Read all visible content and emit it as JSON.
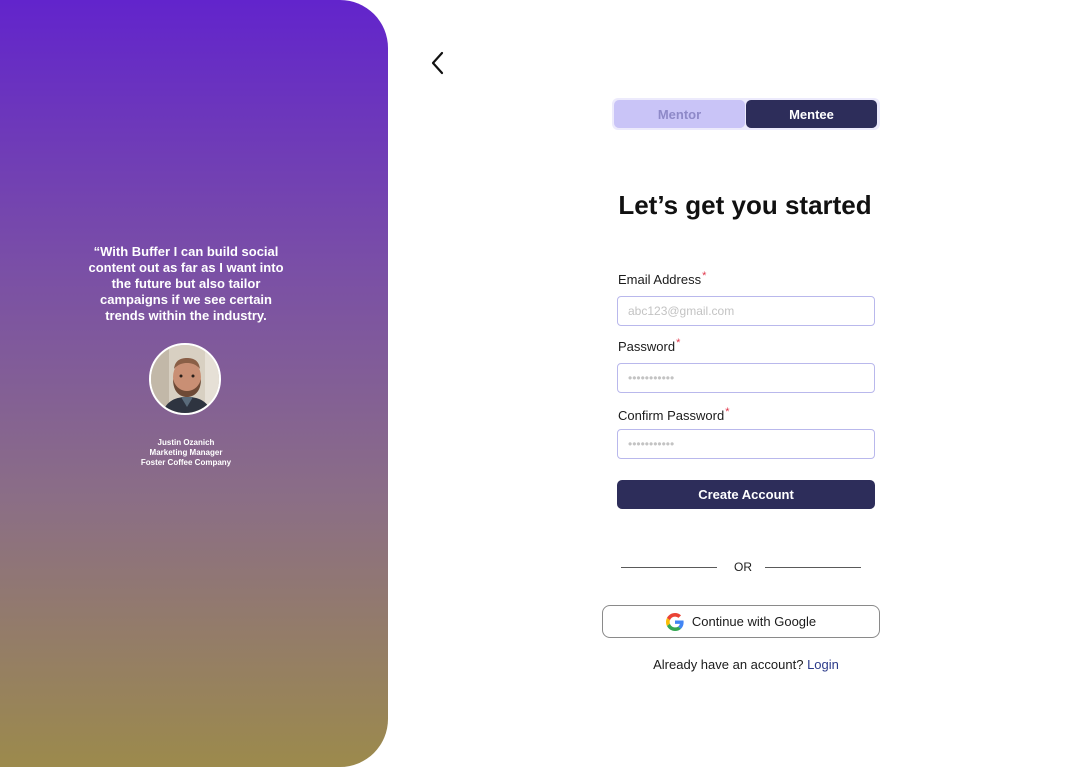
{
  "testimonial": {
    "quote": "“With Buffer I can build social content out as far as I want into the future but also tailor campaigns if we see certain trends within the industry.",
    "author_name": "Justin Ozanich",
    "author_role": "Marketing Manager",
    "author_company": "Foster Coffee Company"
  },
  "nav": {
    "back_icon": "chevron-left-icon"
  },
  "role_toggle": {
    "mentor_label": "Mentor",
    "mentee_label": "Mentee",
    "selected": "Mentee"
  },
  "form": {
    "title": "Let’s get you started",
    "email_label": "Email Address",
    "email_placeholder": "abc123@gmail.com",
    "password_label": "Password",
    "password_placeholder": "•••••••••••",
    "confirm_label": "Confirm Password",
    "confirm_placeholder": "•••••••••••",
    "required_mark": "*",
    "submit_label": "Create Account"
  },
  "divider": {
    "text": "OR"
  },
  "google": {
    "label": "Continue with Google",
    "icon": "google-icon"
  },
  "login_prompt": {
    "text": "Already have an account?",
    "link": "Login"
  },
  "colors": {
    "accent": "#2d2d5a",
    "toggle_inactive_bg": "#c9c4f7",
    "required": "#e0384c",
    "gradient_top": "#6224cc",
    "gradient_bottom": "#9c8a4c"
  }
}
